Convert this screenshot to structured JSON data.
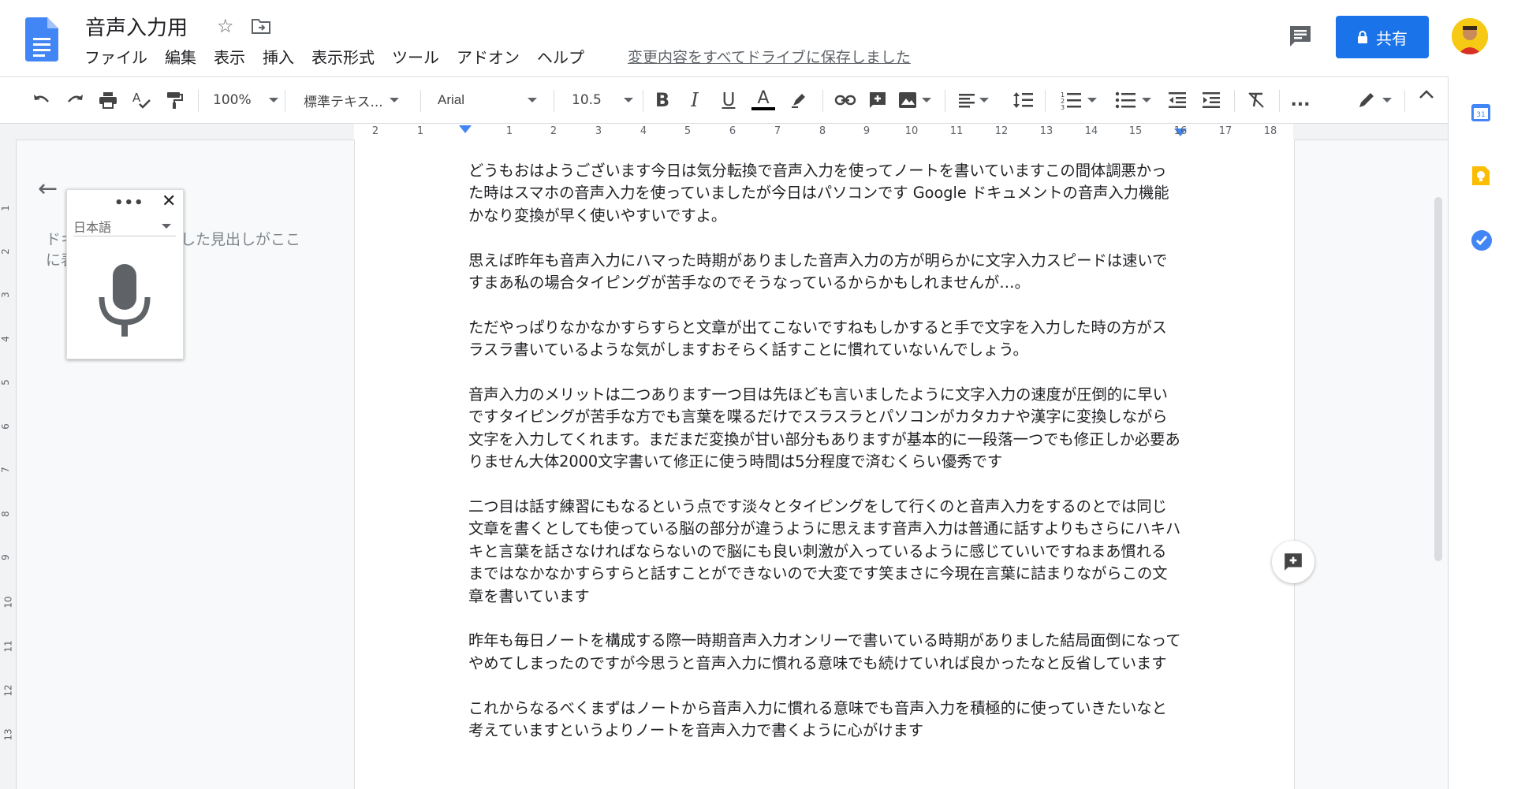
{
  "header": {
    "title": "音声入力用",
    "menu": [
      "ファイル",
      "編集",
      "表示",
      "挿入",
      "表示形式",
      "ツール",
      "アドオン",
      "ヘルプ"
    ],
    "save_status": "変更内容をすべてドライブに保存しました",
    "share_label": "共有"
  },
  "toolbar": {
    "zoom": "100%",
    "style": "標準テキス...",
    "font": "Arial",
    "font_size": "10.5",
    "more": "..."
  },
  "ruler": {
    "numbers": [
      "2",
      "1",
      "1",
      "2",
      "3",
      "4",
      "5",
      "6",
      "7",
      "8",
      "9",
      "10",
      "11",
      "12",
      "13",
      "14",
      "15",
      "16",
      "17",
      "18"
    ],
    "vertical": [
      "1",
      "2",
      "3",
      "4",
      "5",
      "6",
      "7",
      "8",
      "9",
      "10",
      "11",
      "12",
      "13"
    ]
  },
  "outline": {
    "text": "ドキュメントに追加した見出しがここに表示されます"
  },
  "voice": {
    "language": "日本語",
    "dots": "•••",
    "close": "✕"
  },
  "document": {
    "paragraphs": [
      "どうもおはようございます今日は気分転換で音声入力を使ってノートを書いていますこの間体調悪かった時はスマホの音声入力を使っていましたが今日はパソコンです Google ドキュメントの音声入力機能かなり変換が早く使いやすいですよ。",
      "思えば昨年も音声入力にハマった時期がありました音声入力の方が明らかに文字入力スピードは速いですまあ私の場合タイピングが苦手なのでそうなっているからかもしれませんが…。",
      "ただやっぱりなかなかすらすらと文章が出てこないですねもしかすると手で文字を入力した時の方がスラスラ書いているような気がしますおそらく話すことに慣れていないんでしょう。",
      "音声入力のメリットは二つあります一つ目は先ほども言いましたように文字入力の速度が圧倒的に早いですタイピングが苦手な方でも言葉を喋るだけでスラスラとパソコンがカタカナや漢字に変換しながら文字を入力してくれます。まだまだ変換が甘い部分もありますが基本的に一段落一つでも修正しか必要ありません大体2000文字書いて修正に使う時間は5分程度で済むくらい優秀です",
      "二つ目は話す練習にもなるという点です淡々とタイピングをして行くのと音声入力をするのとでは同じ文章を書くとしても使っている脳の部分が違うように思えます音声入力は普通に話すよりもさらにハキハキと言葉を話さなければならないので脳にも良い刺激が入っているように感じていいですねまあ慣れるまではなかなかすらすらと話すことができないので大変です笑まさに今現在言葉に詰まりながらこの文章を書いています",
      "昨年も毎日ノートを構成する際一時期音声入力オンリーで書いている時期がありました結局面倒になってやめてしまったのですが今思うと音声入力に慣れる意味でも続けていれば良かったなと反省しています",
      "これからなるべくまずはノートから音声入力に慣れる意味でも音声入力を積極的に使っていきたいなと考えていますというよりノートを音声入力で書くように心がけます"
    ]
  },
  "colors": {
    "accent": "#1a73e8",
    "doc_icon": "#4285f4"
  },
  "icons": [
    "undo-icon",
    "redo-icon",
    "print-icon",
    "spellcheck-icon",
    "paint-format-icon",
    "bold-icon",
    "italic-icon",
    "underline-icon",
    "text-color-icon",
    "highlight-icon",
    "link-icon",
    "comment-icon",
    "image-icon",
    "align-icon",
    "line-spacing-icon",
    "numbered-list-icon",
    "bulleted-list-icon",
    "indent-decrease-icon",
    "indent-increase-icon",
    "clear-format-icon",
    "edit-mode-icon",
    "chevron-up-icon",
    "calendar-icon",
    "keep-icon",
    "tasks-icon",
    "microphone-icon",
    "lock-icon",
    "star-icon",
    "folder-icon",
    "comments-icon",
    "back-arrow-icon"
  ]
}
